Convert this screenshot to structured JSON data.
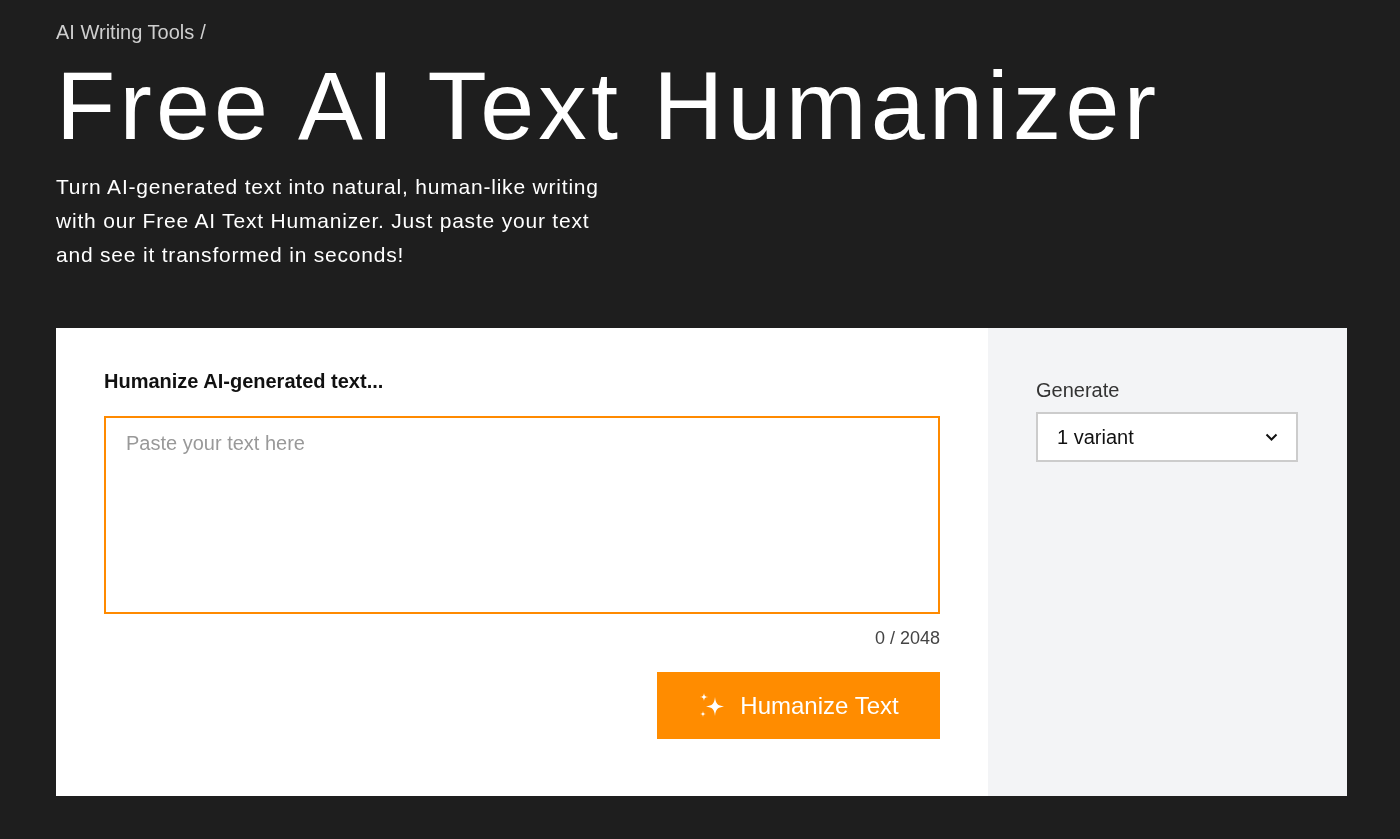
{
  "breadcrumb": {
    "link": "AI Writing Tools",
    "separator": "/"
  },
  "title": "Free AI Text Humanizer",
  "description": "Turn AI-generated text into natural, human-like writing with our Free AI Text Humanizer. Just paste your text and see it transformed in seconds!",
  "form": {
    "label": "Humanize AI-generated text...",
    "input": {
      "placeholder": "Paste your text here",
      "focused": true
    },
    "counter": "0 / 2048",
    "submit_button": {
      "label": "Humanize Text"
    }
  },
  "options": {
    "label": "Generate",
    "select": {
      "value": "1 variant"
    }
  }
}
